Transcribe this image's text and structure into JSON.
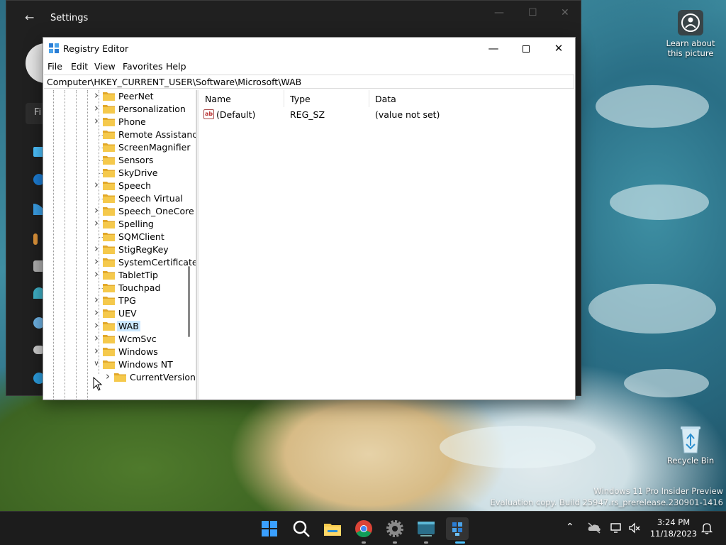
{
  "desktop": {
    "learn_about_label": "Learn about this picture",
    "recycle_bin_label": "Recycle Bin",
    "watermark_line1": "Windows 11 Pro Insider Preview",
    "watermark_line2": "Evaluation copy. Build 25947.rs_prerelease.230901-1416"
  },
  "settings": {
    "title": "Settings",
    "search_partial": "Fi"
  },
  "regedit": {
    "title": "Registry Editor",
    "menu": {
      "file": "File",
      "edit": "Edit",
      "view": "View",
      "favorites": "Favorites",
      "help": "Help"
    },
    "address": "Computer\\HKEY_CURRENT_USER\\Software\\Microsoft\\WAB",
    "tree": [
      {
        "label": "PeerNet",
        "expandable": true
      },
      {
        "label": "Personalization",
        "expandable": true
      },
      {
        "label": "Phone",
        "expandable": true
      },
      {
        "label": "Remote Assistance",
        "expandable": false
      },
      {
        "label": "ScreenMagnifier",
        "expandable": false
      },
      {
        "label": "Sensors",
        "expandable": false
      },
      {
        "label": "SkyDrive",
        "expandable": false
      },
      {
        "label": "Speech",
        "expandable": true
      },
      {
        "label": "Speech Virtual",
        "expandable": false
      },
      {
        "label": "Speech_OneCore",
        "expandable": true
      },
      {
        "label": "Spelling",
        "expandable": true
      },
      {
        "label": "SQMClient",
        "expandable": false
      },
      {
        "label": "StigRegKey",
        "expandable": true
      },
      {
        "label": "SystemCertificates",
        "expandable": true
      },
      {
        "label": "TabletTip",
        "expandable": true
      },
      {
        "label": "Touchpad",
        "expandable": false
      },
      {
        "label": "TPG",
        "expandable": true
      },
      {
        "label": "UEV",
        "expandable": true
      },
      {
        "label": "WAB",
        "expandable": true,
        "selected": true
      },
      {
        "label": "WcmSvc",
        "expandable": true
      },
      {
        "label": "Windows",
        "expandable": true
      },
      {
        "label": "Windows NT",
        "expandable": true,
        "expanded": true
      },
      {
        "label": "CurrentVersion",
        "expandable": true,
        "child": true
      }
    ],
    "columns": {
      "name": "Name",
      "type": "Type",
      "data": "Data"
    },
    "values": [
      {
        "icon": "ab",
        "name": "(Default)",
        "type": "REG_SZ",
        "data": "(value not set)"
      }
    ]
  },
  "taskbar": {
    "time": "3:24 PM",
    "date": "11/18/2023"
  },
  "colors": {
    "accent": "#0078d4",
    "folder": "#f5c94c",
    "selection": "#cce8ff"
  }
}
